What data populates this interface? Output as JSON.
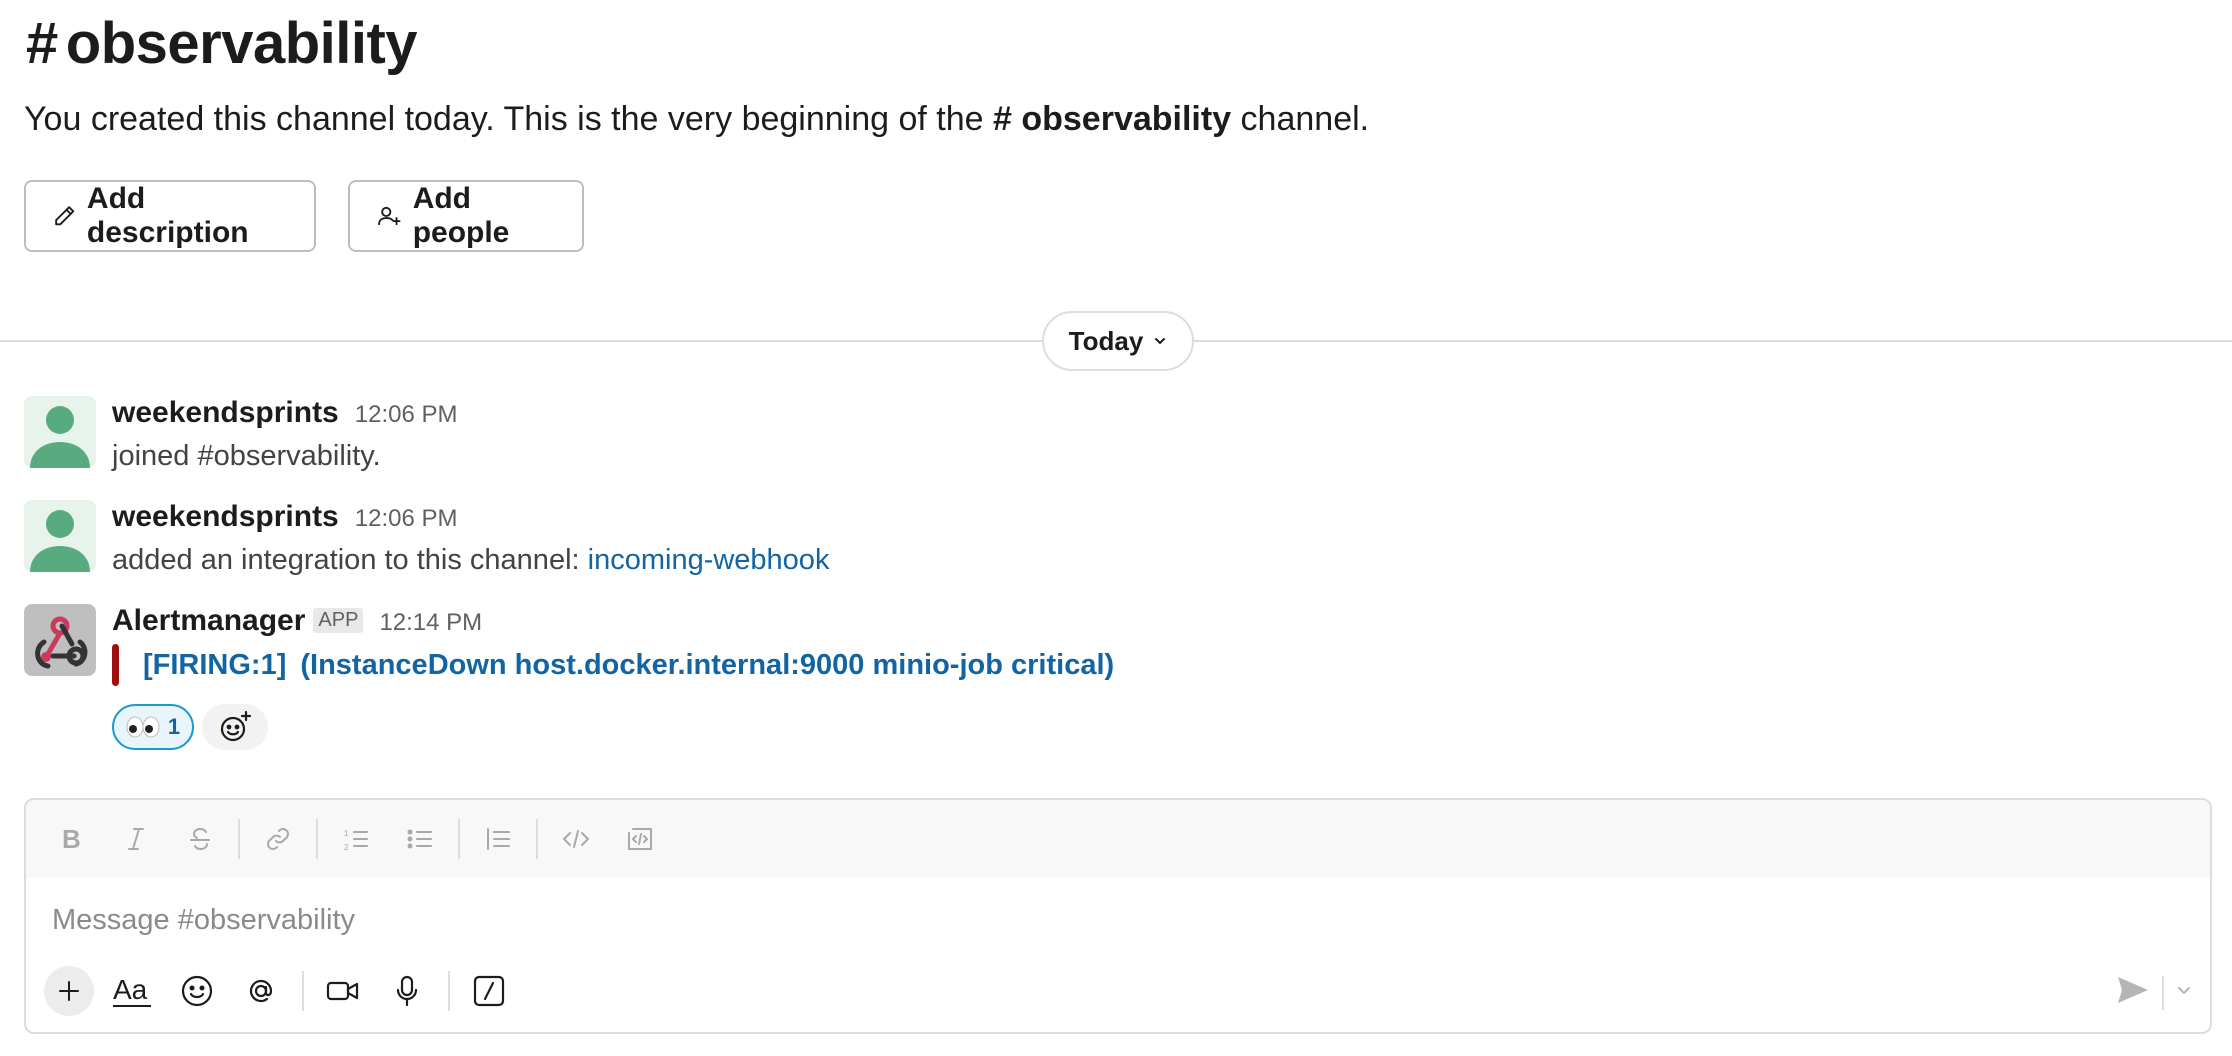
{
  "channel": {
    "hash": "#",
    "name": "observability",
    "intro_prefix": "You created this channel today. This is the very beginning of the ",
    "intro_channel": "# observability",
    "intro_suffix": " channel."
  },
  "intro_buttons": {
    "add_description": "Add description",
    "add_people": "Add people"
  },
  "divider": {
    "label": "Today"
  },
  "messages": [
    {
      "sender": "weekendsprints",
      "time": "12:06 PM",
      "text": "joined #observability."
    },
    {
      "sender": "weekendsprints",
      "time": "12:06 PM",
      "text": "added an integration to this channel: ",
      "link": "incoming-webhook"
    },
    {
      "sender": "Alertmanager",
      "badge": "APP",
      "time": "12:14 PM",
      "alert_status": "[FIRING:1]",
      "alert_text": "(InstanceDown host.docker.internal:9000 minio-job critical)",
      "reactions": [
        {
          "emoji": "eyes-emoji",
          "count": "1"
        }
      ]
    }
  ],
  "composer": {
    "placeholder": "Message #observability",
    "format_tools": [
      "bold-icon",
      "italic-icon",
      "strikethrough-icon",
      "link-icon",
      "ordered-list-icon",
      "bulleted-list-icon",
      "blockquote-icon",
      "code-icon",
      "code-block-icon"
    ],
    "bottom_tools": [
      "plus-icon",
      "text-format-icon",
      "emoji-icon",
      "mention-icon",
      "video-icon",
      "microphone-icon",
      "slash-command-icon"
    ]
  },
  "colors": {
    "link": "#1264a3",
    "alert_bar": "#a00f0f",
    "reaction_border": "#1d9bd1",
    "avatar_green": "#58ab7e"
  }
}
